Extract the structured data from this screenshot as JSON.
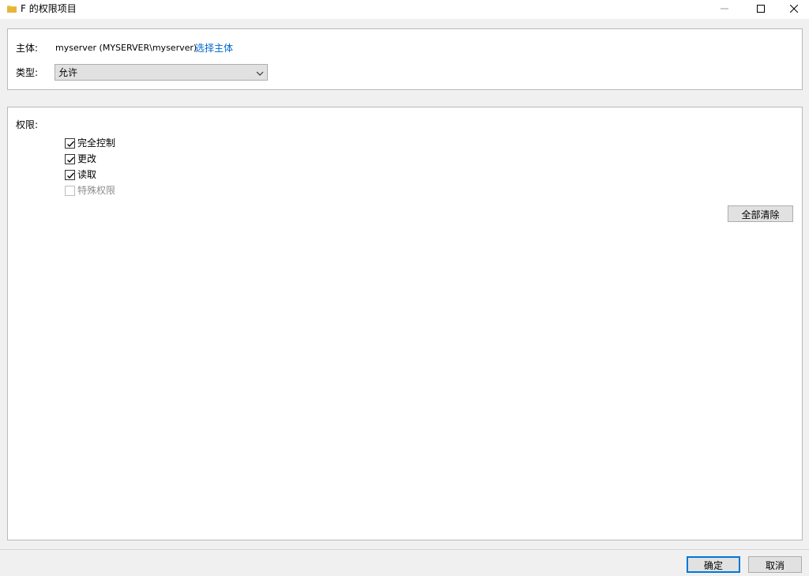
{
  "window": {
    "title": "F 的权限项目",
    "title_icon": "folder-icon",
    "controls": [
      "minimize-icon",
      "maximize-icon",
      "close-icon"
    ]
  },
  "principal": {
    "label": "主体:",
    "value": "myserver (MYSERVER\\myserver)",
    "select_link": "选择主体"
  },
  "type": {
    "label": "类型:",
    "selected": "允许"
  },
  "permissions": {
    "label": "权限:",
    "items": [
      {
        "label": "完全控制",
        "checked": true,
        "enabled": true
      },
      {
        "label": "更改",
        "checked": true,
        "enabled": true
      },
      {
        "label": "读取",
        "checked": true,
        "enabled": true
      },
      {
        "label": "特殊权限",
        "checked": false,
        "enabled": false
      }
    ],
    "clear_all": "全部清除"
  },
  "footer": {
    "ok": "确定",
    "cancel": "取消"
  },
  "colors": {
    "link": "#0066cc",
    "accent": "#0078d7",
    "folder": "#f0c44c"
  }
}
